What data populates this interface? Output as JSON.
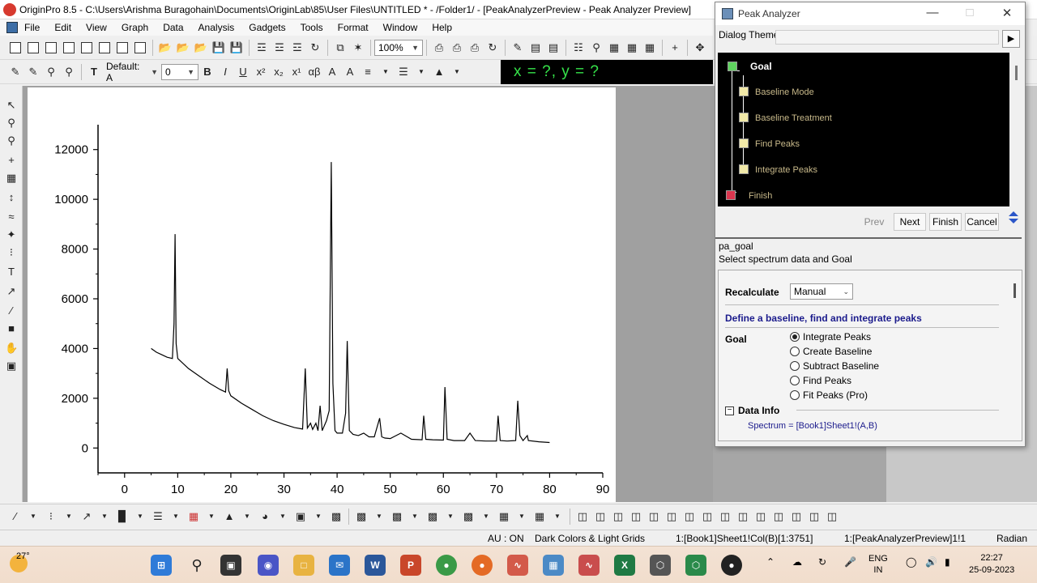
{
  "window": {
    "title": "OriginPro 8.5 - C:\\Users\\Arishma Buragohain\\Documents\\OriginLab\\85\\User Files\\UNTITLED * - /Folder1/ - [PeakAnalyzerPreview - Peak Analyzer Preview]"
  },
  "menu": [
    "File",
    "Edit",
    "View",
    "Graph",
    "Data",
    "Analysis",
    "Gadgets",
    "Tools",
    "Format",
    "Window",
    "Help"
  ],
  "toolbar": {
    "zoom_value": "100%",
    "font_value": "Default: A",
    "size_value": "0",
    "coord_readout": "x = ?, y = ?"
  },
  "chart_data": {
    "type": "line",
    "xlim": [
      -5,
      90
    ],
    "ylim": [
      -1000,
      13000
    ],
    "x_ticks": [
      0,
      10,
      20,
      30,
      40,
      50,
      60,
      70,
      80,
      90
    ],
    "y_ticks": [
      0,
      2000,
      4000,
      6000,
      8000,
      10000,
      12000
    ],
    "x_tick_labels": [
      "0",
      "10",
      "20",
      "30",
      "40",
      "50",
      "60",
      "70",
      "80",
      "90"
    ],
    "y_tick_labels": [
      "0",
      "2000",
      "4000",
      "6000",
      "8000",
      "10000",
      "12000"
    ],
    "x": [
      5,
      6,
      7,
      8,
      9,
      9.3,
      9.5,
      9.7,
      10,
      12,
      14,
      16,
      18,
      19,
      19.3,
      19.6,
      20,
      22,
      24,
      26,
      28,
      30,
      32,
      33.5,
      34,
      34.4,
      35,
      35.4,
      36,
      36.4,
      36.8,
      37.2,
      38,
      38.5,
      38.9,
      39.2,
      39.6,
      40,
      41,
      41.6,
      41.9,
      42.3,
      43,
      44,
      45,
      46,
      47,
      48,
      48.4,
      49,
      50,
      52,
      54,
      56,
      56.3,
      56.7,
      58,
      60,
      60.3,
      60.7,
      62,
      64,
      65,
      66,
      68,
      70,
      70.3,
      70.7,
      72,
      73.6,
      74,
      74.4,
      75,
      75.8,
      76,
      78,
      80
    ],
    "y": [
      4000,
      3850,
      3750,
      3650,
      3600,
      5000,
      8600,
      4200,
      3600,
      3200,
      2900,
      2600,
      2350,
      2250,
      3200,
      2300,
      2100,
      1800,
      1550,
      1300,
      1100,
      950,
      820,
      760,
      3200,
      800,
      1000,
      750,
      1000,
      700,
      1700,
      700,
      1100,
      1500,
      11500,
      2600,
      700,
      600,
      600,
      1400,
      4300,
      700,
      550,
      500,
      600,
      450,
      450,
      1200,
      450,
      400,
      380,
      600,
      350,
      330,
      1300,
      350,
      330,
      320,
      2450,
      350,
      300,
      300,
      600,
      300,
      280,
      280,
      1300,
      300,
      280,
      300,
      1900,
      500,
      300,
      500,
      300,
      250,
      220
    ]
  },
  "dialog": {
    "title": "Peak Analyzer",
    "theme_label": "Dialog Theme",
    "flow": {
      "goal": "Goal",
      "steps": [
        "Baseline Mode",
        "Baseline Treatment",
        "Find Peaks",
        "Integrate Peaks"
      ],
      "finish": "Finish"
    },
    "buttons": {
      "prev": "Prev",
      "next": "Next",
      "finish": "Finish",
      "cancel": "Cancel"
    },
    "page_name": "pa_goal",
    "page_desc": "Select spectrum data and Goal",
    "recalculate_label": "Recalculate",
    "recalculate_value": "Manual",
    "section_title": "Define a baseline, find and integrate peaks",
    "goal_label": "Goal",
    "goal_options": [
      "Integrate Peaks",
      "Create Baseline",
      "Subtract Baseline",
      "Find Peaks",
      "Fit Peaks (Pro)"
    ],
    "data_info_label": "Data Info",
    "spectrum": "Spectrum = [Book1]Sheet1!(A,B)"
  },
  "status": {
    "au": "AU : ON",
    "theme": "Dark Colors & Light Grids",
    "col": "1:[Book1]Sheet1!Col(B)[1:3751]",
    "win": "1:[PeakAnalyzerPreview]1!1",
    "angle": "Radian"
  },
  "taskbar": {
    "temp": "27°",
    "lang_1": "ENG",
    "lang_2": "IN",
    "time": "22:27",
    "date": "25-09-2023"
  },
  "colors": {
    "goal_node": "#5fd35f",
    "step_node": "#f1e9a8",
    "finish_node": "#d9364f",
    "coord_text": "#36e34a"
  }
}
